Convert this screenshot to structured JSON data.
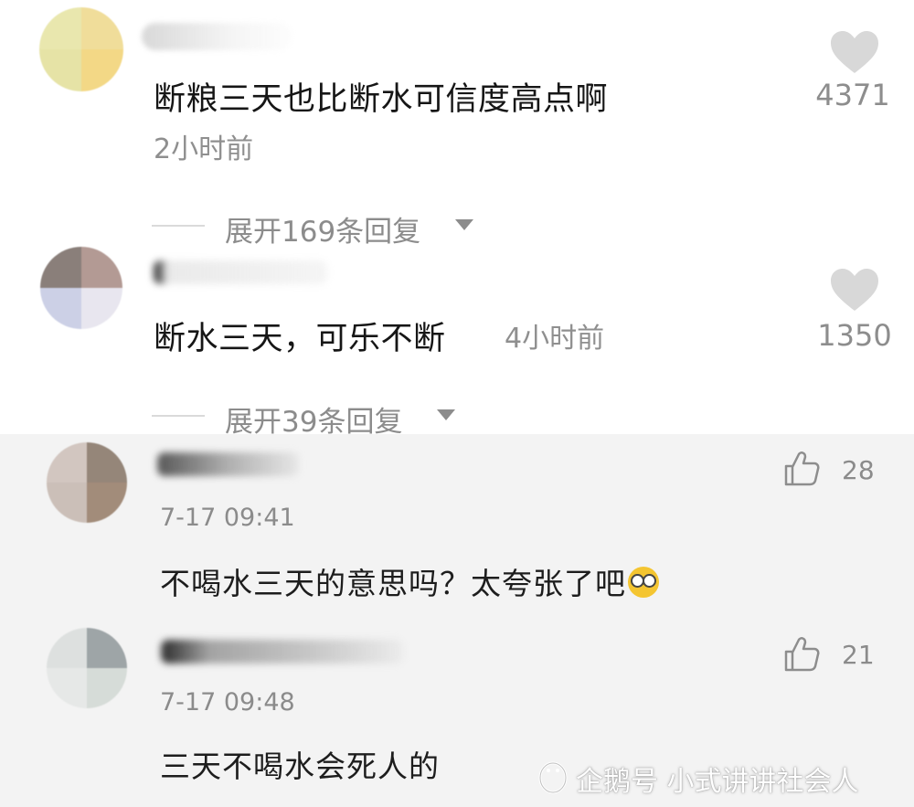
{
  "comments": [
    {
      "text": "断粮三天也比断水可信度高点啊",
      "time": "2小时前",
      "likes": "4371",
      "expand_label": "展开169条回复"
    },
    {
      "text": "断水三天，可乐不断",
      "time": "4小时前",
      "likes": "1350",
      "expand_label": "展开39条回复"
    }
  ],
  "replies": [
    {
      "time": "7-17 09:41",
      "text": "不喝水三天的意思吗？太夸张了吧",
      "emoji": "dizzy-face-emoji",
      "likes": "28"
    },
    {
      "time": "7-17 09:48",
      "text": "三天不喝水会死人的",
      "likes": "21"
    }
  ],
  "watermark": {
    "text": "企鹅号 小式讲讲社会人"
  },
  "colors": {
    "reply_background": "#f3f3f3",
    "heart": "#d8d8d8",
    "muted_text": "#8c8c8c"
  },
  "icons": {
    "like": "heart-icon",
    "reply_like": "thumbs-up-icon",
    "expand": "caret-down-icon",
    "watermark": "penguin-icon"
  }
}
